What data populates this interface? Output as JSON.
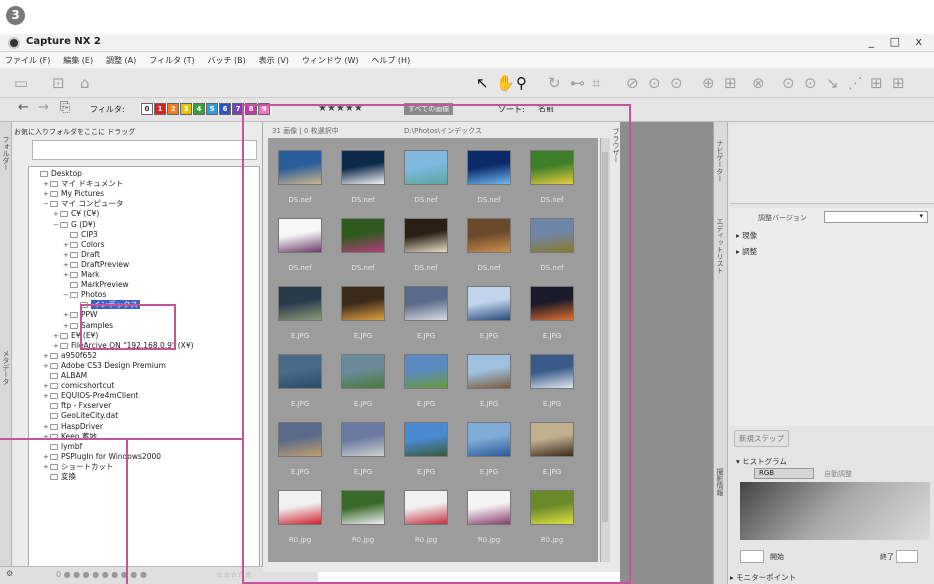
{
  "step_badge": "3",
  "window": {
    "title": "Capture NX 2",
    "controls": "_ □ x"
  },
  "menu": [
    "ファイル (F)",
    "編集 (E)",
    "調整 (A)",
    "フィルタ (T)",
    "バッチ (B)",
    "表示 (V)",
    "ウィンドウ (W)",
    "ヘルプ (H)"
  ],
  "toolbar2": {
    "filter_label": "フィルタ:",
    "label_numbers": [
      "0",
      "1",
      "2",
      "3",
      "4",
      "5",
      "6",
      "7",
      "8",
      "9"
    ],
    "label_colors": [
      "#ffffff",
      "#e02020",
      "#ef7f1a",
      "#e6c200",
      "#3aa23a",
      "#2f9fd0",
      "#3050c8",
      "#7a3fbf",
      "#c43aa8",
      "#ff70c0"
    ],
    "stars": "★★★★★",
    "filter_dropdown": "すべての画像",
    "sort_label": "ソート:",
    "sort_value": "名前"
  },
  "left_panel": {
    "favorites_header": "お気に入りフォルダをここに ドラッグ",
    "vertical_tabs": [
      "フォルダー",
      "メタデータ"
    ]
  },
  "tree": [
    {
      "depth": 0,
      "exp": "",
      "label": "Desktop"
    },
    {
      "depth": 1,
      "exp": "+",
      "label": "マイ ドキュメント"
    },
    {
      "depth": 1,
      "exp": "+",
      "label": "My Pictures"
    },
    {
      "depth": 1,
      "exp": "−",
      "label": "マイ コンピュータ"
    },
    {
      "depth": 2,
      "exp": "+",
      "label": "C¥ (C¥)"
    },
    {
      "depth": 2,
      "exp": "−",
      "label": "G (D¥)"
    },
    {
      "depth": 3,
      "exp": "",
      "label": "CIP3"
    },
    {
      "depth": 3,
      "exp": "+",
      "label": "Colors"
    },
    {
      "depth": 3,
      "exp": "+",
      "label": "Draft"
    },
    {
      "depth": 3,
      "exp": "+",
      "label": "DraftPreview"
    },
    {
      "depth": 3,
      "exp": "+",
      "label": "Mark"
    },
    {
      "depth": 3,
      "exp": "",
      "label": "MarkPreview"
    },
    {
      "depth": 3,
      "exp": "−",
      "label": "Photos"
    },
    {
      "depth": 4,
      "exp": "",
      "label": "インデックス",
      "selected": true
    },
    {
      "depth": 3,
      "exp": "+",
      "label": "PPW"
    },
    {
      "depth": 3,
      "exp": "+",
      "label": "Samples"
    },
    {
      "depth": 2,
      "exp": "+",
      "label": "E¥ (E¥)"
    },
    {
      "depth": 2,
      "exp": "+",
      "label": "FileArcive  ON \"192.168.0.9\" (X¥)"
    },
    {
      "depth": 1,
      "exp": "+",
      "label": "a950f652"
    },
    {
      "depth": 1,
      "exp": "+",
      "label": "Adobe CS3 Design Premium"
    },
    {
      "depth": 1,
      "exp": "",
      "label": "ALBAM"
    },
    {
      "depth": 1,
      "exp": "+",
      "label": "comicshortcut"
    },
    {
      "depth": 1,
      "exp": "+",
      "label": "EQUIOS-Pre4mClient"
    },
    {
      "depth": 1,
      "exp": "",
      "label": "ftp - Fxserver"
    },
    {
      "depth": 1,
      "exp": "",
      "label": "GeoLiteCity.dat"
    },
    {
      "depth": 1,
      "exp": "+",
      "label": "HaspDriver"
    },
    {
      "depth": 1,
      "exp": "+",
      "label": "Keep 蓄地"
    },
    {
      "depth": 1,
      "exp": "",
      "label": "lymbf"
    },
    {
      "depth": 1,
      "exp": "+",
      "label": "PSPlugIn for Windows2000"
    },
    {
      "depth": 1,
      "exp": "+",
      "label": "ショートカット"
    },
    {
      "depth": 1,
      "exp": "",
      "label": "変換"
    }
  ],
  "browser": {
    "count_text": "31 画像 | 0 枚選択中",
    "path_text": "D:\\Photos\\インデックス",
    "side_tab": "ブラウザー",
    "rows": [
      {
        "caption": "DS.nef",
        "colors": [
          [
            "#2a5d9c",
            "#c9b58a"
          ],
          [
            "#0e2a4a",
            "#f2f4f6"
          ],
          [
            "#7fb9e0",
            "#5aa7a0"
          ],
          [
            "#0a2a6a",
            "#6fb8f0"
          ],
          [
            "#3f7f2a",
            "#e6cf3a"
          ]
        ]
      },
      {
        "caption": "DS.nef",
        "colors": [
          [
            "#f6f6f6",
            "#6a3a6a"
          ],
          [
            "#2f5a1f",
            "#b0407a"
          ],
          [
            "#2a1f14",
            "#e6e0c8"
          ],
          [
            "#6a4a2a",
            "#d09050"
          ],
          [
            "#6f85a8",
            "#8a7a2a"
          ]
        ]
      },
      {
        "caption": "E.JPG",
        "colors": [
          [
            "#2a3a4a",
            "#8a9a7a"
          ],
          [
            "#3a2a1a",
            "#e0a040"
          ],
          [
            "#5a6a8a",
            "#d8dce2"
          ],
          [
            "#c0d4ec",
            "#2a4a7a"
          ],
          [
            "#1a1a2a",
            "#e07030"
          ]
        ]
      },
      {
        "caption": "E.JPG",
        "colors": [
          [
            "#4a6a8a",
            "#2a4a6a"
          ],
          [
            "#6a8a9a",
            "#4a7a3a"
          ],
          [
            "#5a8ac0",
            "#6a9a3a"
          ],
          [
            "#a0c0e0",
            "#7a5a3a"
          ],
          [
            "#3a5a8a",
            "#e0e6ee"
          ]
        ]
      },
      {
        "caption": "E.JPG",
        "colors": [
          [
            "#5a6a8a",
            "#c0a070"
          ],
          [
            "#6a7aa0",
            "#d0d0d0"
          ],
          [
            "#4a8ad0",
            "#3a5a3a"
          ],
          [
            "#80aad8",
            "#2a5a9a"
          ],
          [
            "#c0b090",
            "#3a2a1a"
          ]
        ]
      },
      {
        "caption": "R0.jpg",
        "colors": [
          [
            "#f0f0f0",
            "#d02030"
          ],
          [
            "#3a6a2a",
            "#f0f0f0"
          ],
          [
            "#f0f0f0",
            "#c03040"
          ],
          [
            "#f4f4f4",
            "#8a3a6a"
          ],
          [
            "#6a8a2a",
            "#e0e040"
          ]
        ]
      }
    ]
  },
  "right_panel": {
    "vertical_tabs": [
      "ナビゲーター",
      "エディットリスト",
      "撮影情報"
    ],
    "version_label": "調整バージョン",
    "groups": [
      "現像",
      "調整"
    ],
    "new_step": "新規ステップ",
    "histogram_title": "ヒストグラム",
    "channel": "RGB",
    "auto_adjust": "自動調整",
    "start_label": "開始",
    "end_label": "終了",
    "monitor_label": "モニターポイント"
  },
  "bottom_left": {
    "labels": "0 ● ● ● ● ● ● ● ● ●",
    "stars": "☆☆☆☆☆"
  }
}
